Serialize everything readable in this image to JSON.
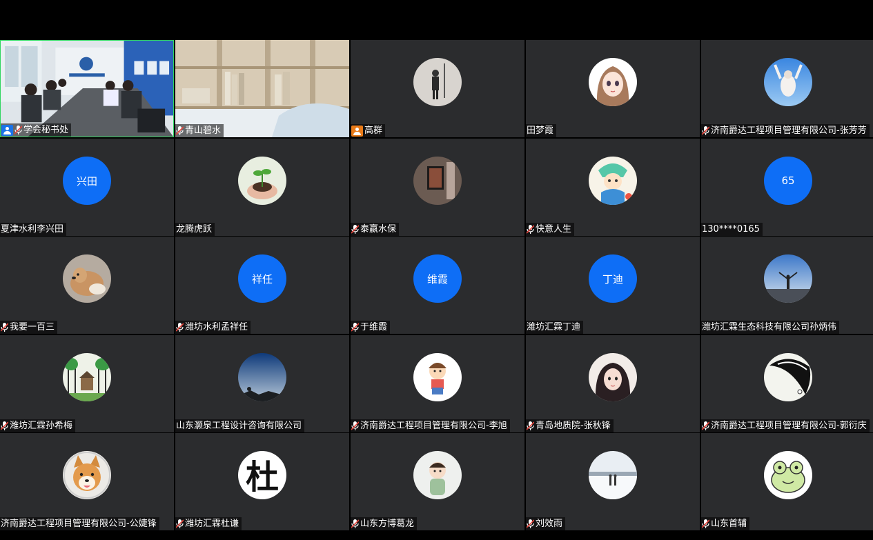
{
  "participants": [
    {
      "name": "学会秘书处",
      "mic": true,
      "badge": "host-blue",
      "video": "meeting-room",
      "avatar_icon": "video-feed"
    },
    {
      "name": "青山碧水",
      "mic": true,
      "badge": "",
      "video": "bookshelf",
      "avatar_icon": "video-feed"
    },
    {
      "name": "高群",
      "mic": false,
      "badge": "host-orange",
      "avatar_icon": "person-photo-icon"
    },
    {
      "name": "田梦霞",
      "mic": false,
      "badge": "",
      "avatar_icon": "anime-girl-icon"
    },
    {
      "name": "济南爵达工程项目管理有限公司-张芳芳",
      "mic": true,
      "badge": "",
      "avatar_icon": "sky-person-icon"
    },
    {
      "name": "夏津水利李兴田",
      "mic": false,
      "badge": "",
      "avatar_text": "兴田"
    },
    {
      "name": "龙腾虎跃",
      "mic": false,
      "badge": "",
      "avatar_icon": "plant-hands-icon"
    },
    {
      "name": "泰嬴水保",
      "mic": true,
      "badge": "",
      "avatar_icon": "painting-photo-icon"
    },
    {
      "name": "快意人生",
      "mic": true,
      "badge": "",
      "avatar_icon": "cartoon-character-icon"
    },
    {
      "name": "130****0165",
      "mic": false,
      "badge": "",
      "avatar_text": "65"
    },
    {
      "name": "我要一百三",
      "mic": true,
      "badge": "",
      "avatar_icon": "dog-photo-icon"
    },
    {
      "name": "潍坊水利孟祥任",
      "mic": true,
      "badge": "",
      "avatar_text": "祥任"
    },
    {
      "name": "于维霞",
      "mic": true,
      "badge": "",
      "avatar_text": "维霞"
    },
    {
      "name": "潍坊汇霖丁迪",
      "mic": false,
      "badge": "",
      "avatar_text": "丁迪"
    },
    {
      "name": "潍坊汇霖生态科技有限公司孙炳伟",
      "mic": false,
      "badge": "",
      "avatar_icon": "mountain-person-icon"
    },
    {
      "name": "潍坊汇霖孙希梅",
      "mic": true,
      "badge": "",
      "avatar_icon": "forest-drawing-icon"
    },
    {
      "name": "山东灏泉工程设计咨询有限公司",
      "mic": false,
      "badge": "",
      "avatar_icon": "sky-silhouette-icon"
    },
    {
      "name": "济南爵达工程项目管理有限公司-李旭",
      "mic": true,
      "badge": "",
      "avatar_icon": "cartoon-boy-icon"
    },
    {
      "name": "青岛地质院-张秋锋",
      "mic": true,
      "badge": "",
      "avatar_icon": "girl-portrait-icon"
    },
    {
      "name": "济南爵达工程项目管理有限公司-郭衍庆",
      "mic": true,
      "badge": "",
      "avatar_icon": "black-white-ball-icon"
    },
    {
      "name": "济南爵达工程项目管理有限公司-公婕锋",
      "mic": false,
      "badge": "",
      "avatar_icon": "shiba-dog-icon"
    },
    {
      "name": "潍坊汇霖杜谦",
      "mic": true,
      "badge": "",
      "avatar_icon": "calligraphy-du-icon",
      "avatar_glyph": "杜"
    },
    {
      "name": "山东方博葛龙",
      "mic": true,
      "badge": "",
      "avatar_icon": "baby-photo-icon"
    },
    {
      "name": "刘效雨",
      "mic": true,
      "badge": "",
      "avatar_icon": "snow-scene-icon"
    },
    {
      "name": "山东首辅",
      "mic": true,
      "badge": "",
      "avatar_icon": "frog-face-icon"
    }
  ],
  "colors": {
    "tile_bg": "#2b2c2e",
    "avatar_blue": "#0e6ef6",
    "speaking_border": "#2fd65f",
    "mic_red": "#e8453c"
  }
}
